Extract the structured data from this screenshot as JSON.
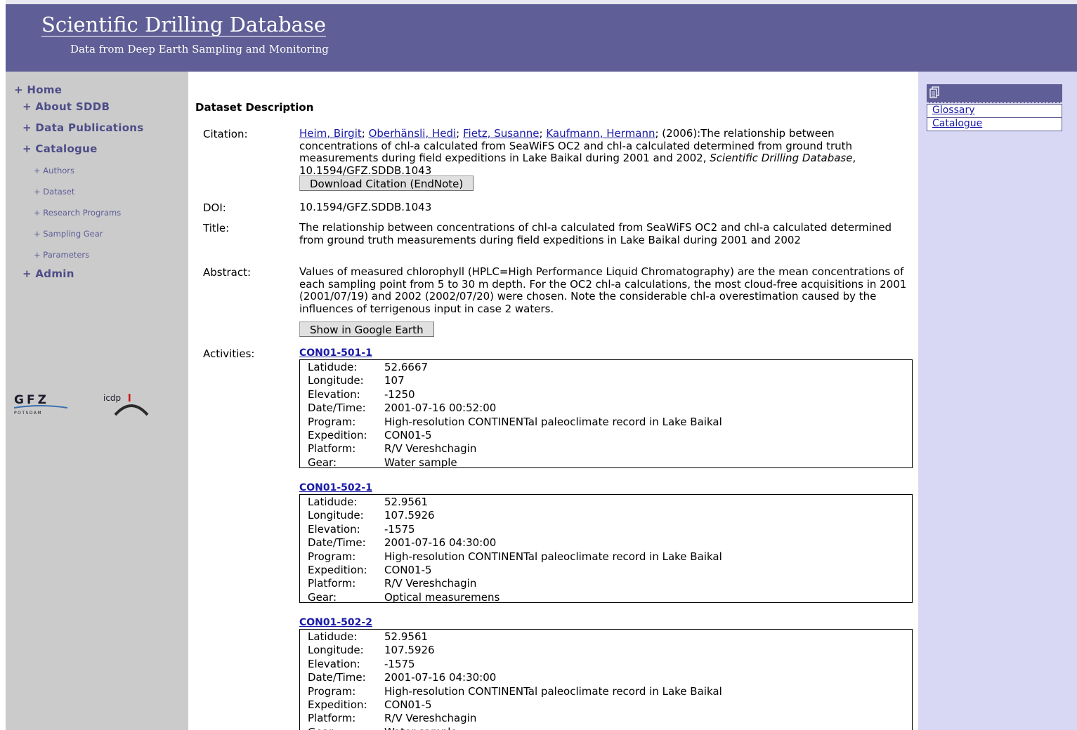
{
  "header": {
    "title": "Scientific Drilling Database",
    "subtitle": "Data from Deep Earth Sampling and Monitoring"
  },
  "sidebar": {
    "home": "+ Home",
    "about": "+ About SDDB",
    "publications": "+ Data Publications",
    "catalogue": "+ Catalogue",
    "authors": "+ Authors",
    "dataset": "+ Dataset",
    "programs": "+ Research Programs",
    "gear": "+ Sampling Gear",
    "parameters": "+ Parameters",
    "admin": "+ Admin",
    "logo_gfz": "GFZ",
    "logo_gfz_sub": "POTSDAM",
    "logo_icdp": "icdp"
  },
  "rightbar": {
    "glossary": "Glossary",
    "catalogue": "Catalogue"
  },
  "main": {
    "section_title": "Dataset Description",
    "labels": {
      "citation": "Citation:",
      "doi": "DOI:",
      "title": "Title:",
      "abstract": "Abstract:",
      "activities": "Activities:"
    },
    "citation": {
      "authors": [
        "Heim, Birgit",
        "Oberhänsli, Hedi",
        "Fietz, Susanne",
        "Kaufmann, Hermann"
      ],
      "year_text": "; (2006):The relationship between concentrations of chl-a calculated from SeaWiFS OC2 and chl-a calculated determined from ground truth measurements during field expeditions in Lake Baikal during 2001 and 2002, ",
      "journal": "Scientific Drilling Database",
      "doi_tail": ", 10.1594/GFZ.SDDB.1043",
      "download_button": "Download Citation (EndNote)"
    },
    "doi": "10.1594/GFZ.SDDB.1043",
    "title": "The relationship between concentrations of chl-a calculated from SeaWiFS OC2 and chl-a calculated determined from ground truth measurements during field expeditions in Lake Baikal during 2001 and 2002",
    "abstract": "Values of measured chlorophyll (HPLC=High Performance Liquid Chromatography) are the mean concentrations of each sampling point from 5 to 30 m depth. For the OC2 chl-a calculations, the most cloud-free acquisitions in 2001 (2001/07/19) and 2002 (2002/07/20) were chosen. Note the considerable chl-a overestimation caused by the influences of terrigenous input in case 2 waters.",
    "google_earth_button": "Show in Google Earth",
    "field_keys": [
      "Latidude:",
      "Longitude:",
      "Elevation:",
      "Date/Time:",
      "Program:",
      "Expedition:",
      "Platform:",
      "Gear:"
    ],
    "activities": [
      {
        "id": "CON01-501-1",
        "values": [
          "52.6667",
          "107",
          "-1250",
          "2001-07-16 00:52:00",
          "High-resolution CONTINENTal paleoclimate record in Lake Baikal",
          "CON01-5",
          "R/V Vereshchagin",
          "Water sample"
        ]
      },
      {
        "id": "CON01-502-1",
        "values": [
          "52.9561",
          "107.5926",
          "-1575",
          "2001-07-16 04:30:00",
          "High-resolution CONTINENTal paleoclimate record in Lake Baikal",
          "CON01-5",
          "R/V Vereshchagin",
          "Optical measuremens"
        ]
      },
      {
        "id": "CON01-502-2",
        "values": [
          "52.9561",
          "107.5926",
          "-1575",
          "2001-07-16 04:30:00",
          "High-resolution CONTINENTal paleoclimate record in Lake Baikal",
          "CON01-5",
          "R/V Vereshchagin",
          "Water sample"
        ]
      }
    ]
  },
  "colors": {
    "header_bg": "#5f5e96",
    "sidebar_bg": "#cbcbcb",
    "rightbar_bg": "#d8d8f4",
    "link": "#1a1aa6",
    "nav": "#4d4c88"
  }
}
